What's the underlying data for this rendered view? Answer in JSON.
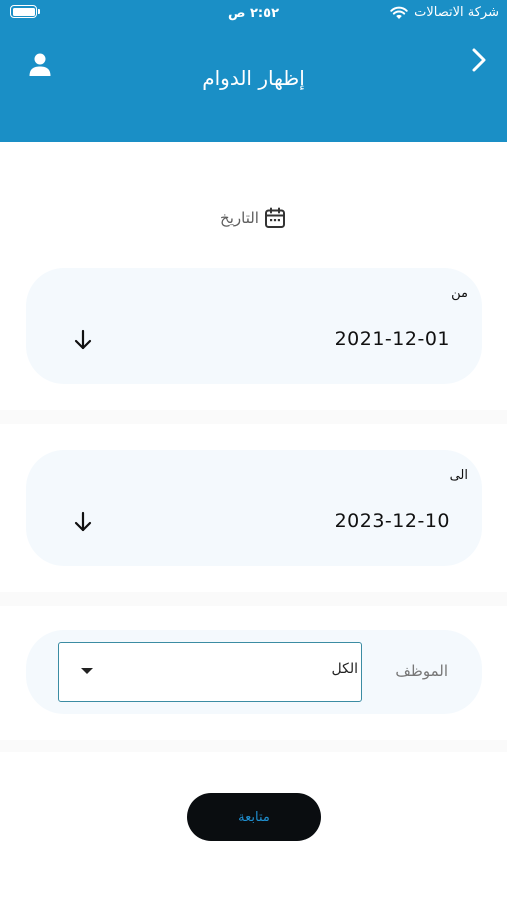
{
  "status_bar": {
    "carrier": "شركة الاتصالات",
    "time": "٢:٥٢ ص",
    "battery_level": 1.0
  },
  "header": {
    "title": "إظهار الدوام",
    "back_icon": "chevron-right-icon",
    "profile_icon": "user-icon",
    "background_color": "#1a8fc6"
  },
  "date_section": {
    "label": "التاريخ",
    "icon": "calendar-icon"
  },
  "from_field": {
    "label": "من",
    "value": "2021-12-01",
    "icon": "arrow-down-icon"
  },
  "to_field": {
    "label": "الى",
    "value": "2023-12-10",
    "icon": "arrow-down-icon"
  },
  "employee_field": {
    "label": "الموظف",
    "selected": "الكل",
    "icon": "dropdown-caret-icon"
  },
  "continue_button": {
    "label": "متابعة",
    "text_color": "#1f8fd0",
    "background_color": "#0a0d10"
  }
}
